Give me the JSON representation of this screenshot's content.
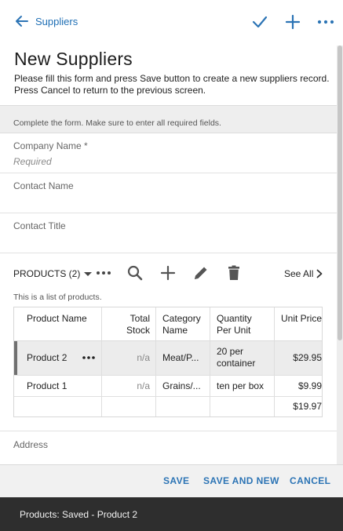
{
  "header": {
    "back_label": "Suppliers",
    "icons": [
      "arrow-left-icon",
      "check-icon",
      "plus-icon",
      "more-icon"
    ]
  },
  "form": {
    "title": "New Suppliers",
    "description": "Please fill this form and press Save button to create a new suppliers record. Press Cancel to return to the previous screen.",
    "hint": "Complete the form. Make sure to enter all required fields.",
    "fields": [
      {
        "label": "Company Name *",
        "placeholder": "Required"
      },
      {
        "label": "Contact Name",
        "placeholder": ""
      },
      {
        "label": "Contact Title",
        "placeholder": ""
      }
    ],
    "address_label": "Address"
  },
  "products": {
    "title": "PRODUCTS (2)",
    "see_all": "See All",
    "description": "This is a list of products.",
    "columns": [
      "Product Name",
      "Total Stock",
      "Category Name",
      "Quantity Per Unit",
      "Unit Price"
    ],
    "rows": [
      {
        "name": "Product 2",
        "stock": "n/a",
        "category": "Meat/P...",
        "qty": "20 per container",
        "price": "$29.95",
        "selected": true
      },
      {
        "name": "Product 1",
        "stock": "n/a",
        "category": "Grains/...",
        "qty": "ten per box",
        "price": "$9.99",
        "selected": false
      }
    ],
    "total": "$19.97"
  },
  "actions": {
    "save": "SAVE",
    "save_and_new": "SAVE AND NEW",
    "cancel": "CANCEL"
  },
  "toast": {
    "message": "Products: Saved - Product 2"
  },
  "colors": {
    "accent": "#2c74b5",
    "toast_bg": "#2e2e2e",
    "selected_row": "#ececec"
  }
}
